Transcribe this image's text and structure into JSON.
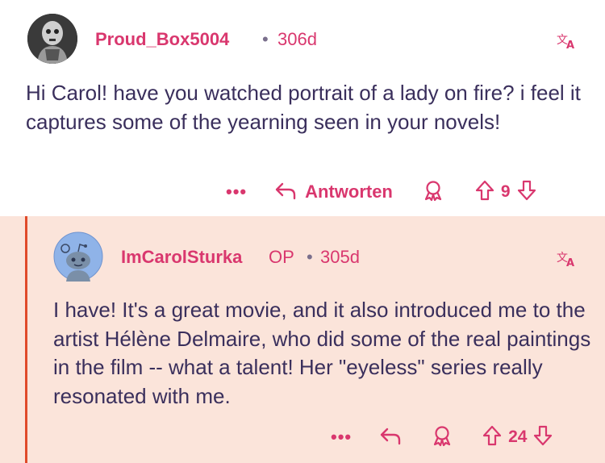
{
  "comments": [
    {
      "username": "Proud_Box5004",
      "separator": "•",
      "age": "306d",
      "body": "Hi Carol! have you watched portrait of a lady on fire? i feel it captures some of the yearning seen in your novels!",
      "reply_label": "Antworten",
      "more": "•••",
      "score": "9"
    },
    {
      "username": "ImCarolSturka",
      "op_badge": "OP",
      "separator": "•",
      "age": "305d",
      "body": "I have!  It's a great movie, and it also introduced me to the artist Hélène Delmaire, who did some of the real paintings in the film -- what a talent! Her \"eyeless\" series really resonated with me.",
      "more": "•••",
      "score": "24"
    }
  ],
  "colors": {
    "accent": "#d9376e",
    "text": "#3a2f5c",
    "thread_line": "#e04a2a",
    "reply_bg": "#fbe4da"
  },
  "icons": [
    "translate-icon",
    "reply-arrow-icon",
    "award-icon",
    "upvote-icon",
    "downvote-icon",
    "more-icon"
  ]
}
